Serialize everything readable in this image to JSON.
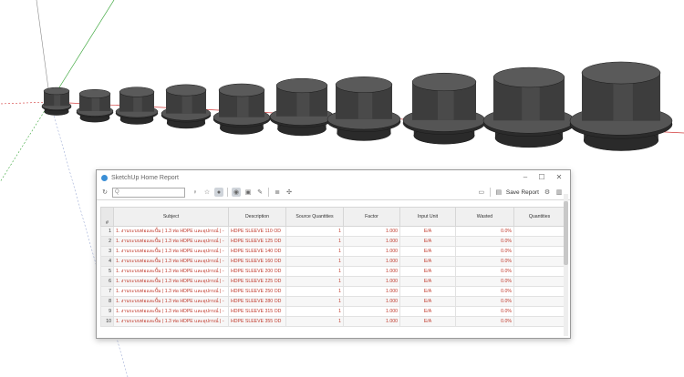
{
  "window": {
    "title": "SketchUp Home Report",
    "controls": {
      "minimize": "–",
      "maximize": "☐",
      "close": "✕"
    }
  },
  "toolbar": {
    "search_placeholder": "Q",
    "save_report": "Save Report",
    "icons": [
      "refresh-icon",
      "lightbulb-icon",
      "star-icon",
      "filter-icon",
      "eye-icon",
      "select-icon",
      "edit-icon",
      "database-icon",
      "crosshair-icon",
      "monitor-icon",
      "save-icon",
      "gear-icon",
      "book-icon"
    ]
  },
  "table": {
    "headers": {
      "index": "#",
      "subject": "Subject",
      "description": "Description",
      "source": "Source Quantities",
      "factor": "Factor",
      "unit": "Input Unit",
      "wasted": "Wasted",
      "quantities": "Quantities"
    },
    "rows": [
      {
        "n": "1",
        "subject": "1. งานระบบท่อและปั้ม | 1.3 ท่อ HDPE และอุปกรณ์ | -",
        "description": "HDPE SLEEVE 110 OD",
        "source": "1",
        "factor": "1.000",
        "unit": "E/A",
        "wasted": "0.0%",
        "qty": ""
      },
      {
        "n": "2",
        "subject": "1. งานระบบท่อและปั้ม | 1.3 ท่อ HDPE และอุปกรณ์ | -",
        "description": "HDPE SLEEVE 125 OD",
        "source": "1",
        "factor": "1.000",
        "unit": "E/A",
        "wasted": "0.0%",
        "qty": ""
      },
      {
        "n": "3",
        "subject": "1. งานระบบท่อและปั้ม | 1.3 ท่อ HDPE และอุปกรณ์ | -",
        "description": "HDPE SLEEVE 140 OD",
        "source": "1",
        "factor": "1.000",
        "unit": "E/A",
        "wasted": "0.0%",
        "qty": ""
      },
      {
        "n": "4",
        "subject": "1. งานระบบท่อและปั้ม | 1.3 ท่อ HDPE และอุปกรณ์ | -",
        "description": "HDPE SLEEVE 160 OD",
        "source": "1",
        "factor": "1.000",
        "unit": "E/A",
        "wasted": "0.0%",
        "qty": ""
      },
      {
        "n": "5",
        "subject": "1. งานระบบท่อและปั้ม | 1.3 ท่อ HDPE และอุปกรณ์ | -",
        "description": "HDPE SLEEVE 200 OD",
        "source": "1",
        "factor": "1.000",
        "unit": "E/A",
        "wasted": "0.0%",
        "qty": ""
      },
      {
        "n": "6",
        "subject": "1. งานระบบท่อและปั้ม | 1.3 ท่อ HDPE และอุปกรณ์ | -",
        "description": "HDPE SLEEVE 225 OD",
        "source": "1",
        "factor": "1.000",
        "unit": "E/A",
        "wasted": "0.0%",
        "qty": ""
      },
      {
        "n": "7",
        "subject": "1. งานระบบท่อและปั้ม | 1.3 ท่อ HDPE และอุปกรณ์ | -",
        "description": "HDPE SLEEVE 250 OD",
        "source": "1",
        "factor": "1.000",
        "unit": "E/A",
        "wasted": "0.0%",
        "qty": ""
      },
      {
        "n": "8",
        "subject": "1. งานระบบท่อและปั้ม | 1.3 ท่อ HDPE และอุปกรณ์ | -",
        "description": "HDPE SLEEVE 280 OD",
        "source": "1",
        "factor": "1.000",
        "unit": "E/A",
        "wasted": "0.0%",
        "qty": ""
      },
      {
        "n": "9",
        "subject": "1. งานระบบท่อและปั้ม | 1.3 ท่อ HDPE และอุปกรณ์ | -",
        "description": "HDPE SLEEVE 315 OD",
        "source": "1",
        "factor": "1.000",
        "unit": "E/A",
        "wasted": "0.0%",
        "qty": ""
      },
      {
        "n": "10",
        "subject": "1. งานระบบท่อและปั้ม | 1.3 ท่อ HDPE และอุปกรณ์ | -",
        "description": "HDPE SLEEVE 355 OD",
        "source": "1",
        "factor": "1.000",
        "unit": "E/A",
        "wasted": "0.0%",
        "qty": ""
      }
    ]
  },
  "colors": {
    "cell_text": "#c0392b",
    "sleeve_body": "#3d3d3d",
    "sleeve_edge": "#1a1a1a",
    "axis_green": "#3aa63a",
    "axis_red": "#d23a3a",
    "axis_blue": "#3a5ad2"
  }
}
